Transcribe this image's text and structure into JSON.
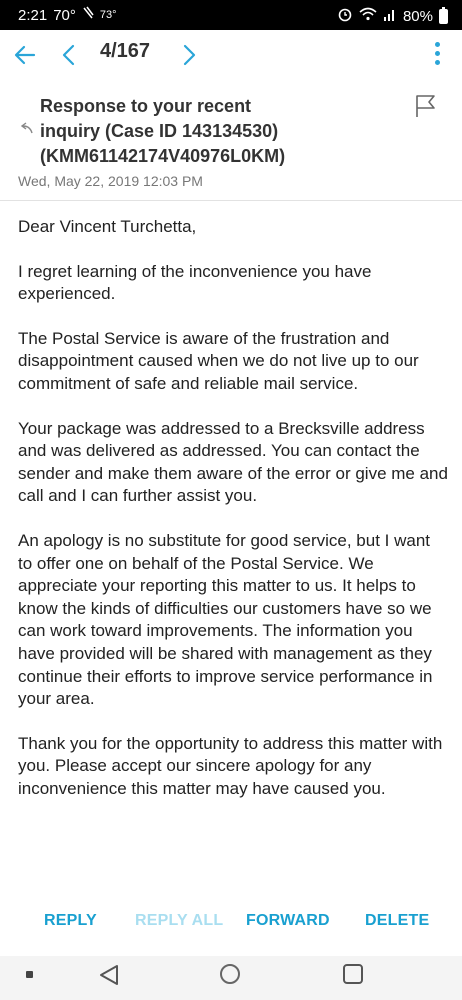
{
  "status_bar": {
    "time": "2:21",
    "temp": "70°",
    "temp2": "73°",
    "battery": "80%"
  },
  "toolbar": {
    "counter": "4/167"
  },
  "email": {
    "subject_lines": [
      "Response to your recent",
      "inquiry (Case ID 143134530)",
      "(KMM61142174V40976L0KM)"
    ],
    "date": "Wed, May 22, 2019 12:03 PM",
    "paragraphs": [
      "Dear Vincent Turchetta,",
      "I regret learning of the inconvenience you have experienced.",
      "The Postal Service is aware of the frustration and disappointment caused when we do not live up to our commitment of safe and reliable mail service.",
      "Your package was addressed to a Brecksville address and was delivered as addressed. You can contact the sender and make them aware of the error or give me and call and I can further assist you.",
      "An apology is no substitute for good service, but I want to offer one on behalf of the Postal Service. We appreciate your reporting this matter to us. It helps to know the kinds of difficulties our customers have so we can work toward improvements. The information you have provided will be shared with management as they continue their efforts to improve service performance in your area.",
      "Thank you for the opportunity to address this matter with you. Please accept our sincere apology for any inconvenience this matter may have caused you."
    ]
  },
  "actions": {
    "reply": "REPLY",
    "reply_all": "REPLY ALL",
    "forward": "FORWARD",
    "delete": "DELETE"
  },
  "colors": {
    "accent": "#2aa5d8",
    "action": "#19a0d0",
    "action_disabled": "#a9def0"
  }
}
